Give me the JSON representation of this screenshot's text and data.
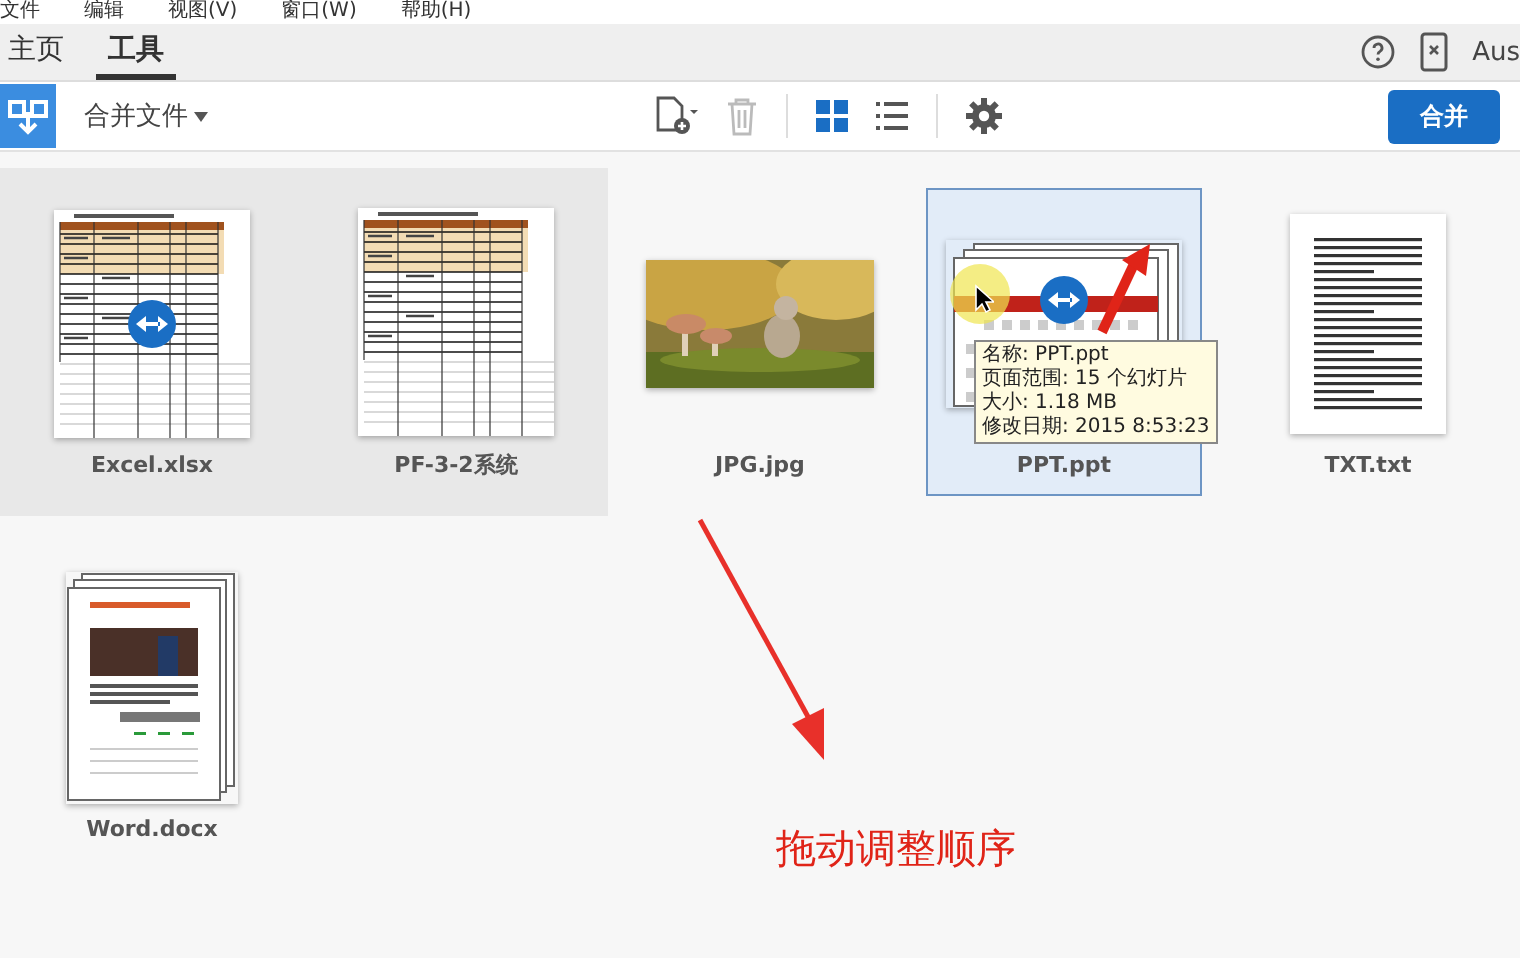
{
  "menu_bar": [
    "文件",
    "编辑",
    "视图(V)",
    "窗口(W)",
    "帮助(H)"
  ],
  "tabs": [
    {
      "label": "主页",
      "selected": false
    },
    {
      "label": "工具",
      "selected": true
    }
  ],
  "account": "Aus",
  "toolbar": {
    "tool_name": "合并文件",
    "view_grid_selected": true,
    "delete_disabled": true,
    "merge_button": "合并"
  },
  "files": [
    {
      "name": "Excel.xlsx",
      "kind": "sheet",
      "highlighted": true,
      "selected": false,
      "swap_badge": true
    },
    {
      "name": "PF-3-2系统",
      "kind": "sheet",
      "highlighted": true,
      "selected": false,
      "swap_badge": false
    },
    {
      "name": "JPG.jpg",
      "kind": "picture",
      "highlighted": false,
      "selected": false,
      "swap_badge": false
    },
    {
      "name": "PPT.ppt",
      "kind": "slides",
      "highlighted": false,
      "selected": true,
      "swap_badge": true
    },
    {
      "name": "TXT.txt",
      "kind": "text",
      "highlighted": false,
      "selected": false,
      "swap_badge": false
    },
    {
      "name": "Word.docx",
      "kind": "doc",
      "highlighted": false,
      "selected": false,
      "swap_badge": false
    }
  ],
  "tooltip": [
    "名称: PPT.ppt",
    "页面范围: 15 个幻灯片",
    "大小: 1.18 MB",
    "修改日期: 2015 8:53:23"
  ],
  "annotation": "拖动调整顺序"
}
